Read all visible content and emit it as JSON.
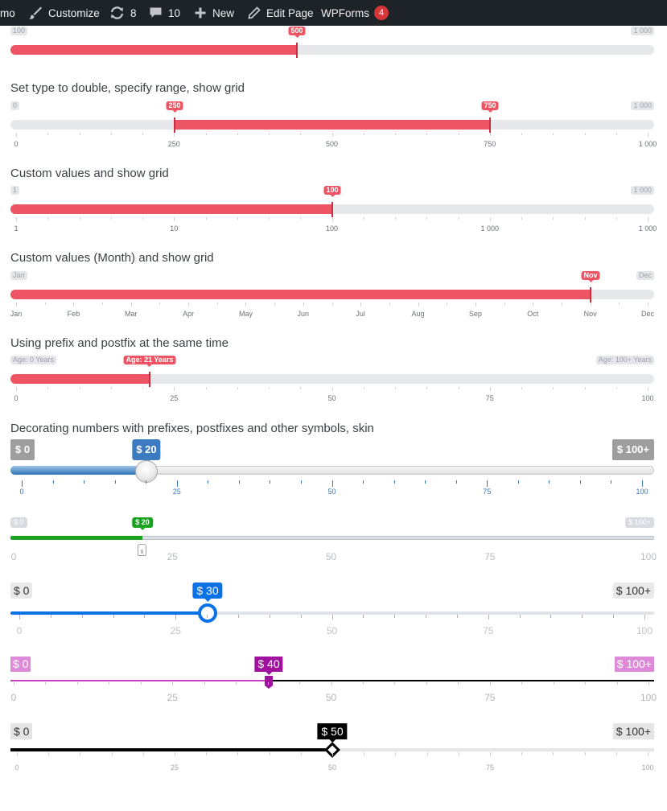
{
  "adminbar": {
    "site_name": "mo",
    "customize": "Customize",
    "updates_count": "8",
    "comments_count": "10",
    "new_label": "New",
    "edit_page": "Edit Page",
    "wpforms": "WPForms",
    "wpforms_badge": "4"
  },
  "sliders": {
    "s1": {
      "min": "100",
      "max": "1 000",
      "value": "500",
      "fraction": 0.444
    },
    "s2": {
      "title": "Set type to double, specify range, show grid",
      "min": "0",
      "max": "1 000",
      "from": "250",
      "to": "750",
      "from_fraction": 0.25,
      "to_fraction": 0.75,
      "grid": [
        "0",
        "250",
        "500",
        "750",
        "1 000"
      ]
    },
    "s3": {
      "title": "Custom values and show grid",
      "min": "1",
      "max": "1 000",
      "value": "100",
      "fraction": 0.5,
      "grid": [
        "1",
        "10",
        "100",
        "1 000",
        "1 000"
      ]
    },
    "s4": {
      "title": "Custom values (Month) and show grid",
      "min": "Jan",
      "max": "Dec",
      "value": "Nov",
      "fraction": 0.909,
      "grid": [
        "Jan",
        "Feb",
        "Mar",
        "Apr",
        "May",
        "Jun",
        "Jul",
        "Aug",
        "Sep",
        "Oct",
        "Nov",
        "Dec"
      ]
    },
    "s5": {
      "title": "Using prefix and postfix at the same time",
      "min": "Age: 0 Years",
      "max": "Age: 100+ Years",
      "value": "Age: 21 Years",
      "fraction": 0.21,
      "grid": [
        "0",
        "25",
        "50",
        "75",
        "100"
      ]
    },
    "s6": {
      "title": "Decorating numbers with prefixes, postfixes and other symbols, skin"
    },
    "s7": {
      "min": "$ 0",
      "max": "$ 100+",
      "value": "$ 20",
      "fraction": 0.2,
      "grid": [
        "0",
        "25",
        "50",
        "75",
        "100"
      ]
    },
    "s8": {
      "min": "$ 0",
      "max": "$ 100+",
      "value": "$ 20",
      "fraction": 0.2,
      "grid": [
        "0",
        "25",
        "50",
        "75",
        "100"
      ]
    },
    "s9": {
      "min": "$ 0",
      "max": "$ 100+",
      "value": "$ 30",
      "fraction": 0.3,
      "grid": [
        "0",
        "25",
        "50",
        "75",
        "100"
      ]
    },
    "s10": {
      "min": "$ 0",
      "max": "$ 100+",
      "value": "$ 40",
      "fraction": 0.4,
      "grid": [
        "0",
        "25",
        "50",
        "75",
        "100"
      ]
    },
    "s11": {
      "min": "$ 0",
      "max": "$ 100+",
      "value": "$ 50",
      "fraction": 0.5,
      "grid": [
        "0",
        "25",
        "50",
        "75",
        "100"
      ]
    }
  },
  "colors": {
    "accent_red": "#ed5565",
    "adminbar_bg": "#1d2327",
    "skin_blue": "#3c7bbf",
    "skin_green": "#1aa31f",
    "skin_modern": "#0a72e6",
    "skin_purple": "#a0129e",
    "skin_sharp": "#000000"
  },
  "icons": [
    "paintbrush-icon",
    "updates-icon",
    "comment-icon",
    "plus-icon",
    "pencil-icon"
  ]
}
